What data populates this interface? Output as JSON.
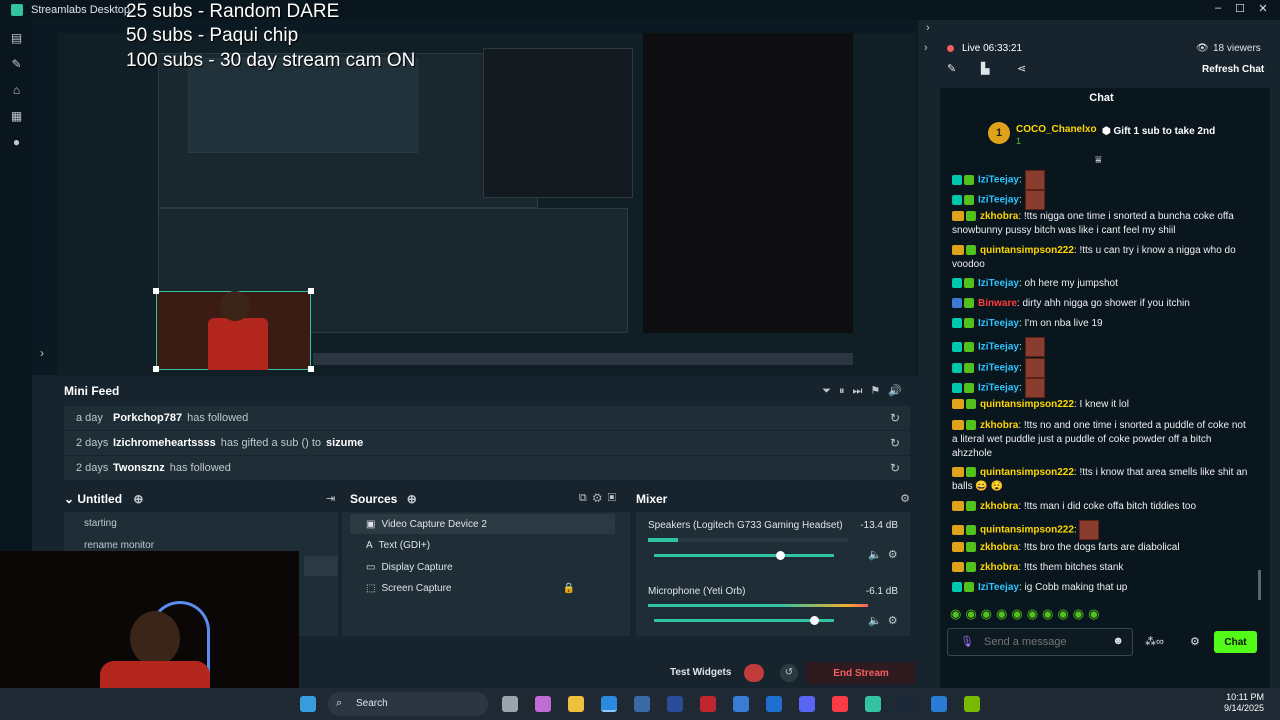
{
  "window": {
    "title": "Streamlabs Desktop",
    "controls": [
      "–",
      "☐",
      "✕"
    ]
  },
  "overlay": {
    "line1": "25 subs - Random DARE",
    "line2": "50 subs - Paqui chip",
    "line3": "100 subs - 30 day stream cam ON"
  },
  "mini_feed": {
    "title": "Mini Feed",
    "events": [
      {
        "when": "a day",
        "name": "Porkchop787",
        "action": "has followed",
        "extra": ""
      },
      {
        "when": "2 days",
        "name": "Izichromeheartssss",
        "action": "has gifted a sub () to",
        "extra": "sizume"
      },
      {
        "when": "2 days",
        "name": "Twonsznz",
        "action": "has followed",
        "extra": ""
      }
    ]
  },
  "scenes": {
    "title": "Untitled",
    "items": [
      "starting",
      "rename monitor"
    ]
  },
  "sources": {
    "title": "Sources",
    "items": [
      "Video Capture Device 2",
      "Text (GDI+)",
      "Display Capture",
      "Screen Capture"
    ]
  },
  "mixer": {
    "title": "Mixer",
    "channels": [
      {
        "name": "Speakers (Logitech G733 Gaming Headset)",
        "db": "-13.4 dB",
        "level": 0.75
      },
      {
        "name": "Microphone (Yeti Orb)",
        "db": "-6.1 dB",
        "level": 0.82
      }
    ]
  },
  "bottom": {
    "test_widgets": "Test Widgets",
    "end_stream": "End Stream"
  },
  "stream": {
    "live_time": "Live 06:33:21",
    "viewers": "18 viewers",
    "refresh_chat": "Refresh Chat"
  },
  "chat": {
    "title": "Chat",
    "pinned_user": "COCO_Chanelxo",
    "pinned_count": "1",
    "pinned_gift": "Gift 1 sub to take 2nd",
    "messages": [
      {
        "user": "IziTeejay",
        "color": "#31c3ff",
        "text": "",
        "emote": true
      },
      {
        "user": "IziTeejay",
        "color": "#31c3ff",
        "text": "",
        "emote": true
      },
      {
        "user": "zkhobra",
        "color": "#ffd700",
        "text": "!tts nigga one time i snorted a buncha coke offa snowbunny pussy bitch was like i cant feel my shiil"
      },
      {
        "user": "quintansimpson222",
        "color": "#ffd700",
        "text": "!tts u can try i know a nigga who do voodoo"
      },
      {
        "user": "IziTeejay",
        "color": "#31c3ff",
        "text": "oh here my jumpshot"
      },
      {
        "user": "Binware",
        "color": "#ff3b3b",
        "text": "dirty ahh nigga go shower if you itchin"
      },
      {
        "user": "IziTeejay",
        "color": "#31c3ff",
        "text": "I'm on nba live 19"
      },
      {
        "user": "IziTeejay",
        "color": "#31c3ff",
        "text": "",
        "emote": true
      },
      {
        "user": "IziTeejay",
        "color": "#31c3ff",
        "text": "",
        "emote": true
      },
      {
        "user": "IziTeejay",
        "color": "#31c3ff",
        "text": "",
        "emote": true
      },
      {
        "user": "quintansimpson222",
        "color": "#ffd700",
        "text": "I knew it lol"
      },
      {
        "user": "zkhobra",
        "color": "#ffd700",
        "text": "!tts no and one time i snorted a puddle of coke not a literal wet puddle just a puddle of coke powder off a bitch ahzzhole"
      },
      {
        "user": "quintansimpson222",
        "color": "#ffd700",
        "text": "!tts i know that area smells like shit an balls 😄 😧"
      },
      {
        "user": "zkhobra",
        "color": "#ffd700",
        "text": "!tts man i did coke offa bitch tiddies too"
      },
      {
        "user": "quintansimpson222",
        "color": "#ffd700",
        "text": "",
        "emote": true
      },
      {
        "user": "zkhobra",
        "color": "#ffd700",
        "text": "!tts bro the dogs farts are diabolical"
      },
      {
        "user": "zkhobra",
        "color": "#ffd700",
        "text": "!tts them bitches stank"
      },
      {
        "user": "IziTeejay",
        "color": "#31c3ff",
        "text": "ig Cobb making that up"
      }
    ],
    "input_placeholder": "Send a message",
    "send_label": "Chat"
  },
  "taskbar": {
    "search": "Search",
    "time": "10:11 PM",
    "date": "9/14/2025"
  },
  "colors": {
    "accent": "#31c3a2",
    "chat_button": "#53fc18",
    "live_red": "#f55e5e"
  }
}
